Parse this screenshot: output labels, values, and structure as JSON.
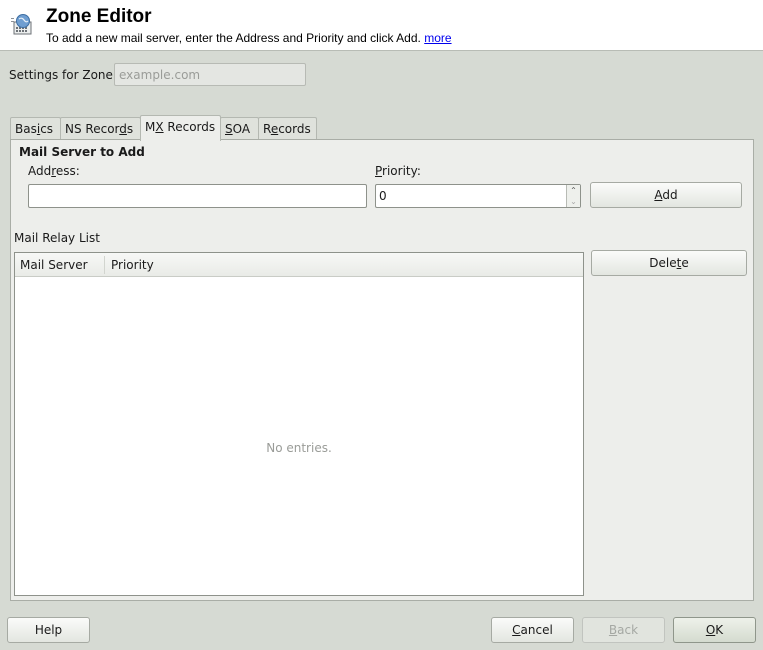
{
  "header": {
    "title": "Zone Editor",
    "description": "To add a new mail server, enter the Address and Priority and click Add.",
    "more_link": "more",
    "icon": "zone-editor-globe-icon"
  },
  "zone": {
    "label": "Settings for Zone",
    "value": "example.com"
  },
  "tabs": [
    {
      "label_pre": "Bas",
      "mnemonic": "i",
      "label_post": "cs",
      "active": false
    },
    {
      "label_pre": "NS Recor",
      "mnemonic": "d",
      "label_post": "s",
      "active": false
    },
    {
      "label_pre": "M",
      "mnemonic": "X",
      "label_post": " Records",
      "active": true
    },
    {
      "label_pre": "",
      "mnemonic": "S",
      "label_post": "OA",
      "active": false
    },
    {
      "label_pre": "R",
      "mnemonic": "e",
      "label_post": "cords",
      "active": false
    }
  ],
  "mail_server_to_add": {
    "group_title": "Mail Server to Add",
    "address_label_pre": "Add",
    "address_label_mnemonic": "r",
    "address_label_post": "ess:",
    "address_value": "",
    "priority_label_mnemonic": "P",
    "priority_label_post": "riority:",
    "priority_value": "0",
    "add_button_mnemonic": "A",
    "add_button_post": "dd"
  },
  "relay_list": {
    "label": "Mail Relay List",
    "columns": [
      "Mail Server",
      "Priority"
    ],
    "rows": [],
    "empty_text": "No entries.",
    "delete_button_pre": "Dele",
    "delete_button_mnemonic": "t",
    "delete_button_post": "e"
  },
  "footer": {
    "help": "Help",
    "cancel_mnemonic": "C",
    "cancel_post": "ancel",
    "back_mnemonic": "B",
    "back_post": "ack",
    "ok_mnemonic": "O",
    "ok_post": "K"
  }
}
